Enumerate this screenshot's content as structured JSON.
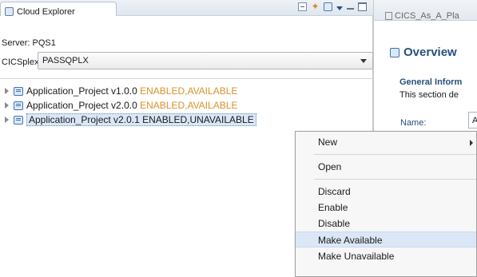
{
  "explorer": {
    "tab_title": "Cloud Explorer",
    "server_label": "Server: PQS1",
    "cicsplex_label": "CICSplex:",
    "cicsplex_value": "PASSQPLX",
    "tree": [
      {
        "name": "Application_Project v1.0.0",
        "status": "ENABLED,AVAILABLE",
        "selected": false
      },
      {
        "name": "Application_Project v2.0.0",
        "status": "ENABLED,AVAILABLE",
        "selected": false
      },
      {
        "name": "Application_Project v2.0.1",
        "status": "ENABLED,UNAVAILABLE",
        "selected": true
      }
    ]
  },
  "editor": {
    "tab_title": "CICS_As_A_Pla",
    "overview_title": "Overview",
    "general_heading": "General Inform",
    "section_desc": "This section de",
    "name_label": "Name:",
    "name_value": "A"
  },
  "context_menu": {
    "items": [
      {
        "label": "New",
        "has_submenu": true
      },
      {
        "label": "Open"
      },
      {
        "label": "Discard"
      },
      {
        "label": "Enable"
      },
      {
        "label": "Disable"
      },
      {
        "label": "Make Available"
      },
      {
        "label": "Make Unavailable"
      }
    ]
  },
  "colors": {
    "status_enabled": "#d8922c",
    "selection": "#dbe7f6",
    "heading": "#274f7a"
  }
}
